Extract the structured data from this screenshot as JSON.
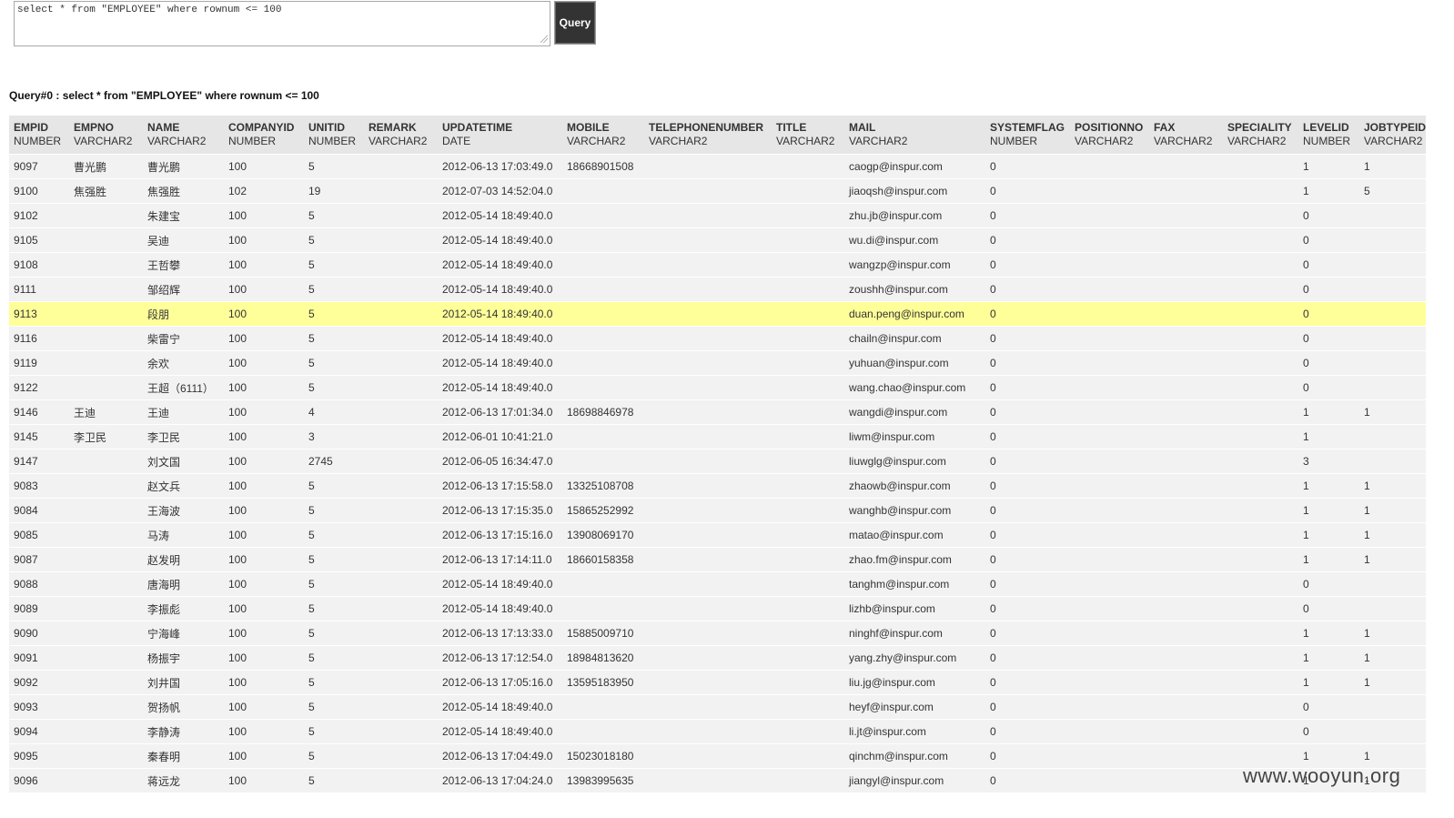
{
  "query": {
    "sql": "select * from \"EMPLOYEE\" where rownum <= 100",
    "button_label": "Query",
    "result_title": "Query#0 : select * from \"EMPLOYEE\" where rownum <= 100"
  },
  "columns": [
    {
      "name": "EMPID",
      "type": "NUMBER"
    },
    {
      "name": "EMPNO",
      "type": "VARCHAR2"
    },
    {
      "name": "NAME",
      "type": "VARCHAR2"
    },
    {
      "name": "COMPANYID",
      "type": "NUMBER"
    },
    {
      "name": "UNITID",
      "type": "NUMBER"
    },
    {
      "name": "REMARK",
      "type": "VARCHAR2"
    },
    {
      "name": "UPDATETIME",
      "type": "DATE"
    },
    {
      "name": "MOBILE",
      "type": "VARCHAR2"
    },
    {
      "name": "TELEPHONENUMBER",
      "type": "VARCHAR2"
    },
    {
      "name": "TITLE",
      "type": "VARCHAR2"
    },
    {
      "name": "MAIL",
      "type": "VARCHAR2"
    },
    {
      "name": "SYSTEMFLAG",
      "type": "NUMBER"
    },
    {
      "name": "POSITIONNO",
      "type": "VARCHAR2"
    },
    {
      "name": "FAX",
      "type": "VARCHAR2"
    },
    {
      "name": "SPECIALITY",
      "type": "VARCHAR2"
    },
    {
      "name": "LEVELID",
      "type": "NUMBER"
    },
    {
      "name": "JOBTYPEID",
      "type": "VARCHAR2"
    }
  ],
  "rows": [
    [
      "9097",
      "曹光鹏",
      "曹光鹏",
      "100",
      "5",
      "",
      "2012-06-13 17:03:49.0",
      "18668901508",
      "",
      "",
      "caogp@inspur.com",
      "0",
      "",
      "",
      "",
      "1",
      "1"
    ],
    [
      "9100",
      "焦强胜",
      "焦强胜",
      "102",
      "19",
      "",
      "2012-07-03 14:52:04.0",
      "",
      "",
      "",
      "jiaoqsh@inspur.com",
      "0",
      "",
      "",
      "",
      "1",
      "5"
    ],
    [
      "9102",
      "",
      "朱建宝",
      "100",
      "5",
      "",
      "2012-05-14 18:49:40.0",
      "",
      "",
      "",
      "zhu.jb@inspur.com",
      "0",
      "",
      "",
      "",
      "0",
      ""
    ],
    [
      "9105",
      "",
      "吴迪",
      "100",
      "5",
      "",
      "2012-05-14 18:49:40.0",
      "",
      "",
      "",
      "wu.di@inspur.com",
      "0",
      "",
      "",
      "",
      "0",
      ""
    ],
    [
      "9108",
      "",
      "王哲攀",
      "100",
      "5",
      "",
      "2012-05-14 18:49:40.0",
      "",
      "",
      "",
      "wangzp@inspur.com",
      "0",
      "",
      "",
      "",
      "0",
      ""
    ],
    [
      "9111",
      "",
      "邹绍辉",
      "100",
      "5",
      "",
      "2012-05-14 18:49:40.0",
      "",
      "",
      "",
      "zoushh@inspur.com",
      "0",
      "",
      "",
      "",
      "0",
      ""
    ],
    [
      "9113",
      "",
      "段朋",
      "100",
      "5",
      "",
      "2012-05-14 18:49:40.0",
      "",
      "",
      "",
      "duan.peng@inspur.com",
      "0",
      "",
      "",
      "",
      "0",
      ""
    ],
    [
      "9116",
      "",
      "柴雷宁",
      "100",
      "5",
      "",
      "2012-05-14 18:49:40.0",
      "",
      "",
      "",
      "chailn@inspur.com",
      "0",
      "",
      "",
      "",
      "0",
      ""
    ],
    [
      "9119",
      "",
      "余欢",
      "100",
      "5",
      "",
      "2012-05-14 18:49:40.0",
      "",
      "",
      "",
      "yuhuan@inspur.com",
      "0",
      "",
      "",
      "",
      "0",
      ""
    ],
    [
      "9122",
      "",
      "王超（6111）",
      "100",
      "5",
      "",
      "2012-05-14 18:49:40.0",
      "",
      "",
      "",
      "wang.chao@inspur.com",
      "0",
      "",
      "",
      "",
      "0",
      ""
    ],
    [
      "9146",
      "王迪",
      "王迪",
      "100",
      "4",
      "",
      "2012-06-13 17:01:34.0",
      "18698846978",
      "",
      "",
      "wangdi@inspur.com",
      "0",
      "",
      "",
      "",
      "1",
      "1"
    ],
    [
      "9145",
      "李卫民",
      "李卫民",
      "100",
      "3",
      "",
      "2012-06-01 10:41:21.0",
      "",
      "",
      "",
      "liwm@inspur.com",
      "0",
      "",
      "",
      "",
      "1",
      ""
    ],
    [
      "9147",
      "",
      "刘文国",
      "100",
      "2745",
      "",
      "2012-06-05 16:34:47.0",
      "",
      "",
      "",
      "liuwglg@inspur.com",
      "0",
      "",
      "",
      "",
      "3",
      ""
    ],
    [
      "9083",
      "",
      "赵文兵",
      "100",
      "5",
      "",
      "2012-06-13 17:15:58.0",
      "13325108708",
      "",
      "",
      "zhaowb@inspur.com",
      "0",
      "",
      "",
      "",
      "1",
      "1"
    ],
    [
      "9084",
      "",
      "王海波",
      "100",
      "5",
      "",
      "2012-06-13 17:15:35.0",
      "15865252992",
      "",
      "",
      "wanghb@inspur.com",
      "0",
      "",
      "",
      "",
      "1",
      "1"
    ],
    [
      "9085",
      "",
      "马涛",
      "100",
      "5",
      "",
      "2012-06-13 17:15:16.0",
      "13908069170",
      "",
      "",
      "matao@inspur.com",
      "0",
      "",
      "",
      "",
      "1",
      "1"
    ],
    [
      "9087",
      "",
      "赵发明",
      "100",
      "5",
      "",
      "2012-06-13 17:14:11.0",
      "18660158358",
      "",
      "",
      "zhao.fm@inspur.com",
      "0",
      "",
      "",
      "",
      "1",
      "1"
    ],
    [
      "9088",
      "",
      "唐海明",
      "100",
      "5",
      "",
      "2012-05-14 18:49:40.0",
      "",
      "",
      "",
      "tanghm@inspur.com",
      "0",
      "",
      "",
      "",
      "0",
      ""
    ],
    [
      "9089",
      "",
      "李振彪",
      "100",
      "5",
      "",
      "2012-05-14 18:49:40.0",
      "",
      "",
      "",
      "lizhb@inspur.com",
      "0",
      "",
      "",
      "",
      "0",
      ""
    ],
    [
      "9090",
      "",
      "宁海峰",
      "100",
      "5",
      "",
      "2012-06-13 17:13:33.0",
      "15885009710",
      "",
      "",
      "ninghf@inspur.com",
      "0",
      "",
      "",
      "",
      "1",
      "1"
    ],
    [
      "9091",
      "",
      "杨振宇",
      "100",
      "5",
      "",
      "2012-06-13 17:12:54.0",
      "18984813620",
      "",
      "",
      "yang.zhy@inspur.com",
      "0",
      "",
      "",
      "",
      "1",
      "1"
    ],
    [
      "9092",
      "",
      "刘井国",
      "100",
      "5",
      "",
      "2012-06-13 17:05:16.0",
      "13595183950",
      "",
      "",
      "liu.jg@inspur.com",
      "0",
      "",
      "",
      "",
      "1",
      "1"
    ],
    [
      "9093",
      "",
      "贺扬帆",
      "100",
      "5",
      "",
      "2012-05-14 18:49:40.0",
      "",
      "",
      "",
      "heyf@inspur.com",
      "0",
      "",
      "",
      "",
      "0",
      ""
    ],
    [
      "9094",
      "",
      "李静涛",
      "100",
      "5",
      "",
      "2012-05-14 18:49:40.0",
      "",
      "",
      "",
      "li.jt@inspur.com",
      "0",
      "",
      "",
      "",
      "0",
      ""
    ],
    [
      "9095",
      "",
      "秦春明",
      "100",
      "5",
      "",
      "2012-06-13 17:04:49.0",
      "15023018180",
      "",
      "",
      "qinchm@inspur.com",
      "0",
      "",
      "",
      "",
      "1",
      "1"
    ],
    [
      "9096",
      "",
      "蒋远龙",
      "100",
      "5",
      "",
      "2012-06-13 17:04:24.0",
      "13983995635",
      "",
      "",
      "jiangyl@inspur.com",
      "0",
      "",
      "",
      "",
      "1",
      "1"
    ]
  ],
  "highlighted_row": 6,
  "colors": {
    "highlight": "#ffff99",
    "header_bg": "#e6e6e6",
    "row_bg": "#f2f2f2",
    "button_bg": "#333333"
  },
  "watermark": "www.wooyun.org"
}
